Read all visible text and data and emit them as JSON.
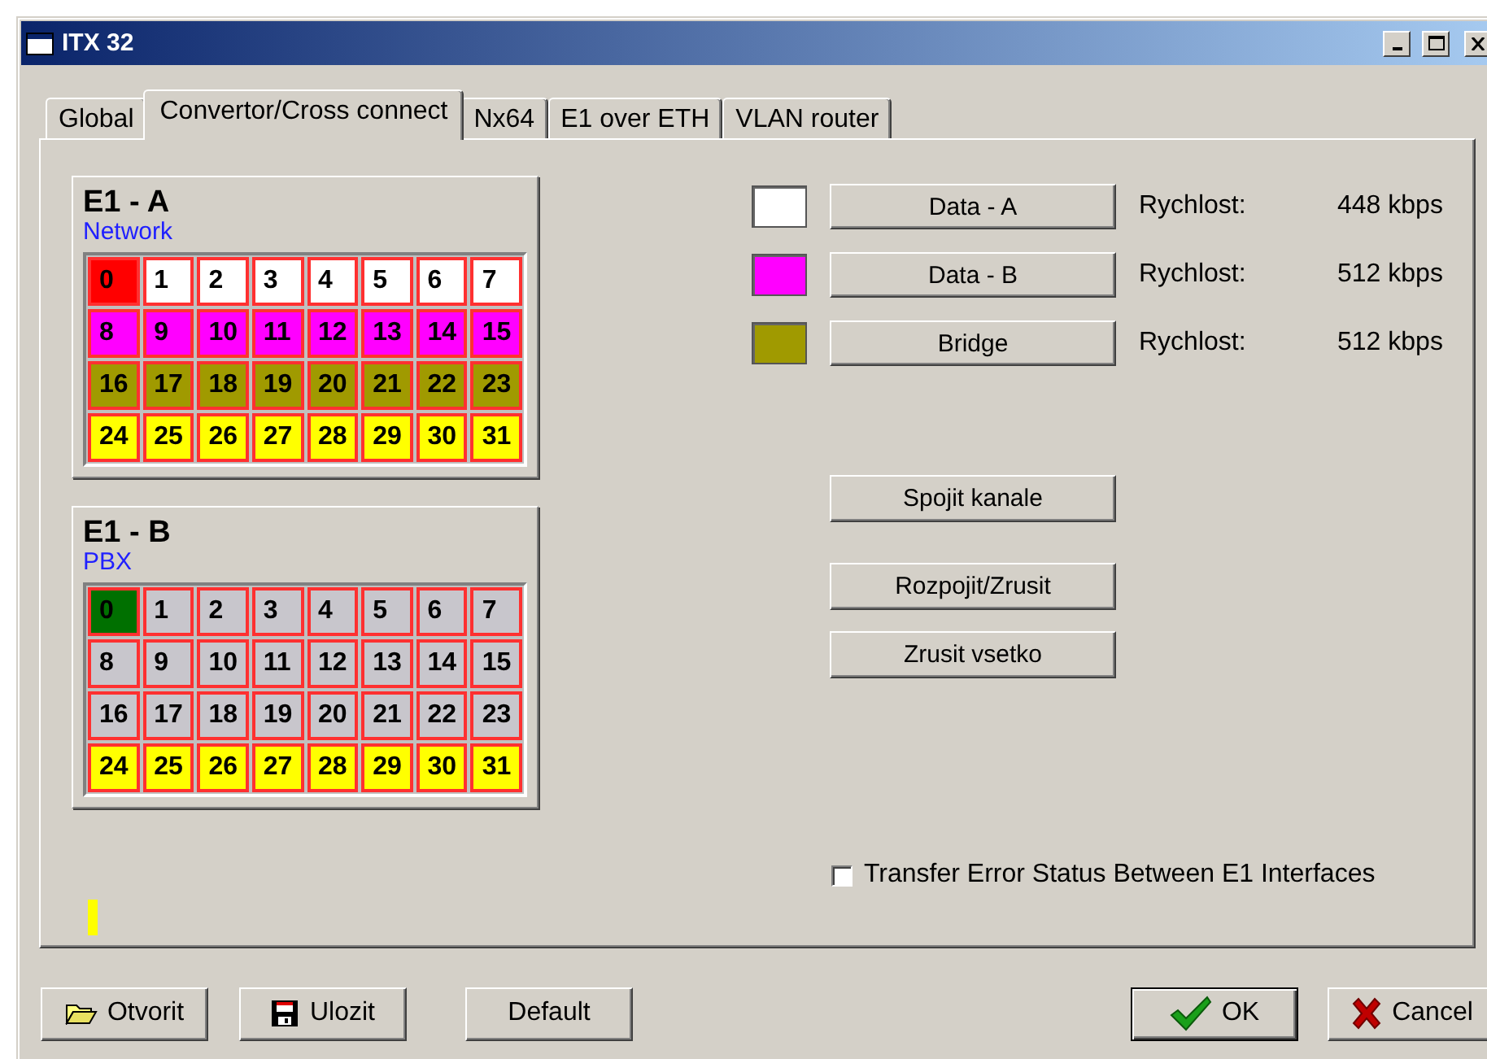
{
  "window": {
    "title": "ITX 32"
  },
  "tabs": [
    {
      "label": "Global",
      "selected": false
    },
    {
      "label": "Convertor/Cross connect",
      "selected": true
    },
    {
      "label": "Nx64",
      "selected": false
    },
    {
      "label": "E1 over ETH",
      "selected": false
    },
    {
      "label": "VLAN router",
      "selected": false
    }
  ],
  "interfaces": [
    {
      "name": "E1 - A",
      "role": "Network",
      "channels": [
        {
          "number": "0",
          "color": "#ff0000"
        },
        {
          "number": "1",
          "color": "#ffffff"
        },
        {
          "number": "2",
          "color": "#ffffff"
        },
        {
          "number": "3",
          "color": "#ffffff"
        },
        {
          "number": "4",
          "color": "#ffffff"
        },
        {
          "number": "5",
          "color": "#ffffff"
        },
        {
          "number": "6",
          "color": "#ffffff"
        },
        {
          "number": "7",
          "color": "#ffffff"
        },
        {
          "number": "8",
          "color": "#ff00ff"
        },
        {
          "number": "9",
          "color": "#ff00ff"
        },
        {
          "number": "10",
          "color": "#ff00ff"
        },
        {
          "number": "11",
          "color": "#ff00ff"
        },
        {
          "number": "12",
          "color": "#ff00ff"
        },
        {
          "number": "13",
          "color": "#ff00ff"
        },
        {
          "number": "14",
          "color": "#ff00ff"
        },
        {
          "number": "15",
          "color": "#ff00ff"
        },
        {
          "number": "16",
          "color": "#a09a00"
        },
        {
          "number": "17",
          "color": "#a09a00"
        },
        {
          "number": "18",
          "color": "#a09a00"
        },
        {
          "number": "19",
          "color": "#a09a00"
        },
        {
          "number": "20",
          "color": "#a09a00"
        },
        {
          "number": "21",
          "color": "#a09a00"
        },
        {
          "number": "22",
          "color": "#a09a00"
        },
        {
          "number": "23",
          "color": "#a09a00"
        },
        {
          "number": "24",
          "color": "#ffff00"
        },
        {
          "number": "25",
          "color": "#ffff00"
        },
        {
          "number": "26",
          "color": "#ffff00"
        },
        {
          "number": "27",
          "color": "#ffff00"
        },
        {
          "number": "28",
          "color": "#ffff00"
        },
        {
          "number": "29",
          "color": "#ffff00"
        },
        {
          "number": "30",
          "color": "#ffff00"
        },
        {
          "number": "31",
          "color": "#ffff00"
        }
      ]
    },
    {
      "name": "E1 - B",
      "role": "PBX",
      "channels": [
        {
          "number": "0",
          "color": "#007000"
        },
        {
          "number": "1",
          "color": "#c8c6cc"
        },
        {
          "number": "2",
          "color": "#c8c6cc"
        },
        {
          "number": "3",
          "color": "#c8c6cc"
        },
        {
          "number": "4",
          "color": "#c8c6cc"
        },
        {
          "number": "5",
          "color": "#c8c6cc"
        },
        {
          "number": "6",
          "color": "#c8c6cc"
        },
        {
          "number": "7",
          "color": "#c8c6cc"
        },
        {
          "number": "8",
          "color": "#c8c6cc"
        },
        {
          "number": "9",
          "color": "#c8c6cc"
        },
        {
          "number": "10",
          "color": "#c8c6cc"
        },
        {
          "number": "11",
          "color": "#c8c6cc"
        },
        {
          "number": "12",
          "color": "#c8c6cc"
        },
        {
          "number": "13",
          "color": "#c8c6cc"
        },
        {
          "number": "14",
          "color": "#c8c6cc"
        },
        {
          "number": "15",
          "color": "#c8c6cc"
        },
        {
          "number": "16",
          "color": "#c8c6cc"
        },
        {
          "number": "17",
          "color": "#c8c6cc"
        },
        {
          "number": "18",
          "color": "#c8c6cc"
        },
        {
          "number": "19",
          "color": "#c8c6cc"
        },
        {
          "number": "20",
          "color": "#c8c6cc"
        },
        {
          "number": "21",
          "color": "#c8c6cc"
        },
        {
          "number": "22",
          "color": "#c8c6cc"
        },
        {
          "number": "23",
          "color": "#c8c6cc"
        },
        {
          "number": "24",
          "color": "#ffff00"
        },
        {
          "number": "25",
          "color": "#ffff00"
        },
        {
          "number": "26",
          "color": "#ffff00"
        },
        {
          "number": "27",
          "color": "#ffff00"
        },
        {
          "number": "28",
          "color": "#ffff00"
        },
        {
          "number": "29",
          "color": "#ffff00"
        },
        {
          "number": "30",
          "color": "#ffff00"
        },
        {
          "number": "31",
          "color": "#ffff00"
        }
      ]
    }
  ],
  "legend": [
    {
      "color": "#ffffff",
      "button": "Data - A",
      "speed_label": "Rychlost:",
      "speed": "448 kbps"
    },
    {
      "color": "#ff00ff",
      "button": "Data - B",
      "speed_label": "Rychlost:",
      "speed": "512 kbps"
    },
    {
      "color": "#a09a00",
      "button": "Bridge",
      "speed_label": "Rychlost:",
      "speed": "512 kbps"
    }
  ],
  "actions": [
    {
      "label": "Spojit kanale"
    },
    {
      "label": "Rozpojit/Zrusit"
    },
    {
      "label": "Zrusit vsetko"
    }
  ],
  "transfer_error_status": {
    "label": "Transfer Error Status Between E1 Interfaces",
    "checked": false
  },
  "footer_buttons": [
    {
      "label": "Otvorit",
      "kind": "open"
    },
    {
      "label": "Ulozit",
      "kind": "save"
    },
    {
      "label": "Default",
      "kind": "plain"
    },
    {
      "label": "OK",
      "kind": "ok"
    },
    {
      "label": "Cancel",
      "kind": "cancel"
    }
  ]
}
